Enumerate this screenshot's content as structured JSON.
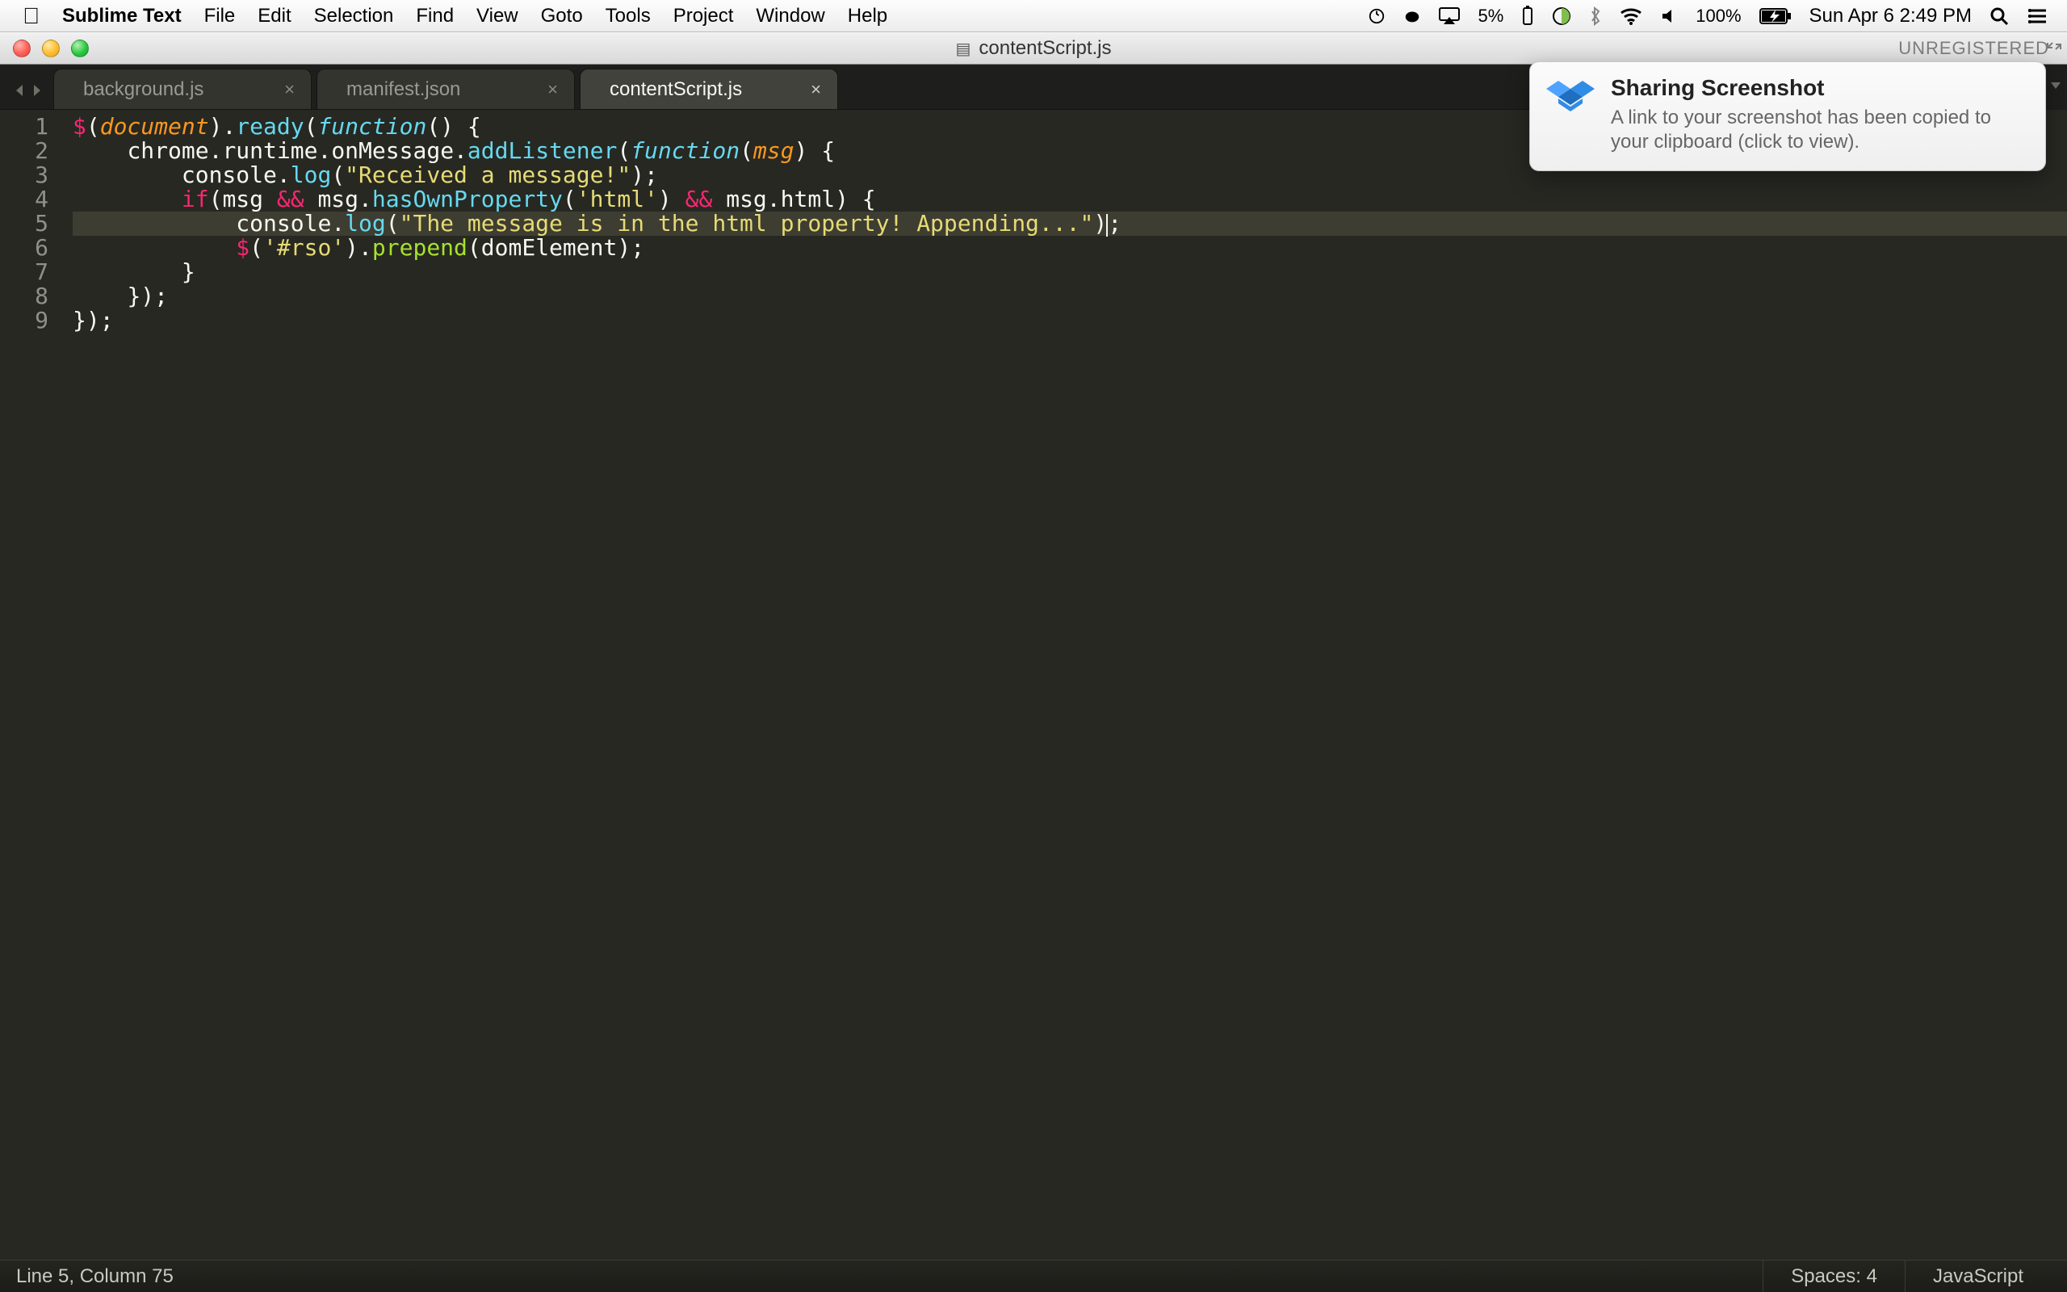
{
  "menubar": {
    "app_name": "Sublime Text",
    "items": [
      "File",
      "Edit",
      "Selection",
      "Find",
      "View",
      "Goto",
      "Tools",
      "Project",
      "Window",
      "Help"
    ],
    "right": {
      "battery1": "5%",
      "battery2": "100%",
      "datetime": "Sun Apr 6  2:49 PM"
    }
  },
  "window": {
    "title": "contentScript.js",
    "registration": "UNREGISTERED"
  },
  "tabs": [
    {
      "label": "background.js",
      "active": false
    },
    {
      "label": "manifest.json",
      "active": false
    },
    {
      "label": "contentScript.js",
      "active": true
    }
  ],
  "editor": {
    "line_numbers": [
      "1",
      "2",
      "3",
      "4",
      "5",
      "6",
      "7",
      "8",
      "9"
    ],
    "highlighted_line_index": 4,
    "code_tokens": [
      [
        {
          "t": "$",
          "c": "kw"
        },
        {
          "t": "(",
          "c": "punc"
        },
        {
          "t": "document",
          "c": "var"
        },
        {
          "t": ")",
          "c": "punc"
        },
        {
          "t": ".",
          "c": "punc"
        },
        {
          "t": "ready",
          "c": "fnname"
        },
        {
          "t": "(",
          "c": "punc"
        },
        {
          "t": "function",
          "c": "fn"
        },
        {
          "t": "()",
          "c": "punc"
        },
        {
          "t": " {",
          "c": "punc"
        }
      ],
      [
        {
          "t": "    ",
          "c": "punc"
        },
        {
          "t": "chrome",
          "c": "ident"
        },
        {
          "t": ".",
          "c": "punc"
        },
        {
          "t": "runtime",
          "c": "ident"
        },
        {
          "t": ".",
          "c": "punc"
        },
        {
          "t": "onMessage",
          "c": "ident"
        },
        {
          "t": ".",
          "c": "punc"
        },
        {
          "t": "addListener",
          "c": "fnname"
        },
        {
          "t": "(",
          "c": "punc"
        },
        {
          "t": "function",
          "c": "fn"
        },
        {
          "t": "(",
          "c": "punc"
        },
        {
          "t": "msg",
          "c": "var"
        },
        {
          "t": ")",
          "c": "punc"
        },
        {
          "t": " {",
          "c": "punc"
        }
      ],
      [
        {
          "t": "        ",
          "c": "punc"
        },
        {
          "t": "console",
          "c": "ident"
        },
        {
          "t": ".",
          "c": "punc"
        },
        {
          "t": "log",
          "c": "fnname"
        },
        {
          "t": "(",
          "c": "punc"
        },
        {
          "t": "\"Received a message!\"",
          "c": "str"
        },
        {
          "t": ");",
          "c": "punc"
        }
      ],
      [
        {
          "t": "        ",
          "c": "punc"
        },
        {
          "t": "if",
          "c": "kw"
        },
        {
          "t": "(",
          "c": "punc"
        },
        {
          "t": "msg ",
          "c": "ident"
        },
        {
          "t": "&&",
          "c": "kw"
        },
        {
          "t": " msg",
          "c": "ident"
        },
        {
          "t": ".",
          "c": "punc"
        },
        {
          "t": "hasOwnProperty",
          "c": "fnname"
        },
        {
          "t": "(",
          "c": "punc"
        },
        {
          "t": "'html'",
          "c": "str"
        },
        {
          "t": ")",
          "c": "punc"
        },
        {
          "t": " ",
          "c": "punc"
        },
        {
          "t": "&&",
          "c": "kw"
        },
        {
          "t": " msg",
          "c": "ident"
        },
        {
          "t": ".",
          "c": "punc"
        },
        {
          "t": "html",
          "c": "ident"
        },
        {
          "t": ")",
          "c": "punc"
        },
        {
          "t": " {",
          "c": "punc"
        }
      ],
      [
        {
          "t": "            ",
          "c": "punc"
        },
        {
          "t": "console",
          "c": "ident"
        },
        {
          "t": ".",
          "c": "punc"
        },
        {
          "t": "log",
          "c": "fnname"
        },
        {
          "t": "(",
          "c": "punc"
        },
        {
          "t": "\"The message is in the html property! Appending...\"",
          "c": "str"
        },
        {
          "t": ")",
          "c": "punc"
        },
        {
          "t": ";",
          "c": "punc",
          "cursor": true
        }
      ],
      [
        {
          "t": "            ",
          "c": "punc"
        },
        {
          "t": "$",
          "c": "kw"
        },
        {
          "t": "(",
          "c": "punc"
        },
        {
          "t": "'#rso'",
          "c": "str"
        },
        {
          "t": ")",
          "c": "punc"
        },
        {
          "t": ".",
          "c": "punc"
        },
        {
          "t": "prepend",
          "c": "callg"
        },
        {
          "t": "(",
          "c": "punc"
        },
        {
          "t": "domElement",
          "c": "ident"
        },
        {
          "t": ");",
          "c": "punc"
        }
      ],
      [
        {
          "t": "        ",
          "c": "punc"
        },
        {
          "t": "}",
          "c": "punc"
        }
      ],
      [
        {
          "t": "    ",
          "c": "punc"
        },
        {
          "t": "});",
          "c": "punc"
        }
      ],
      [
        {
          "t": "});",
          "c": "punc"
        }
      ]
    ]
  },
  "statusbar": {
    "position": "Line 5, Column 75",
    "spaces": "Spaces: 4",
    "syntax": "JavaScript"
  },
  "notification": {
    "title": "Sharing Screenshot",
    "body": "A link to your screenshot has been copied to your clipboard (click to view)."
  }
}
